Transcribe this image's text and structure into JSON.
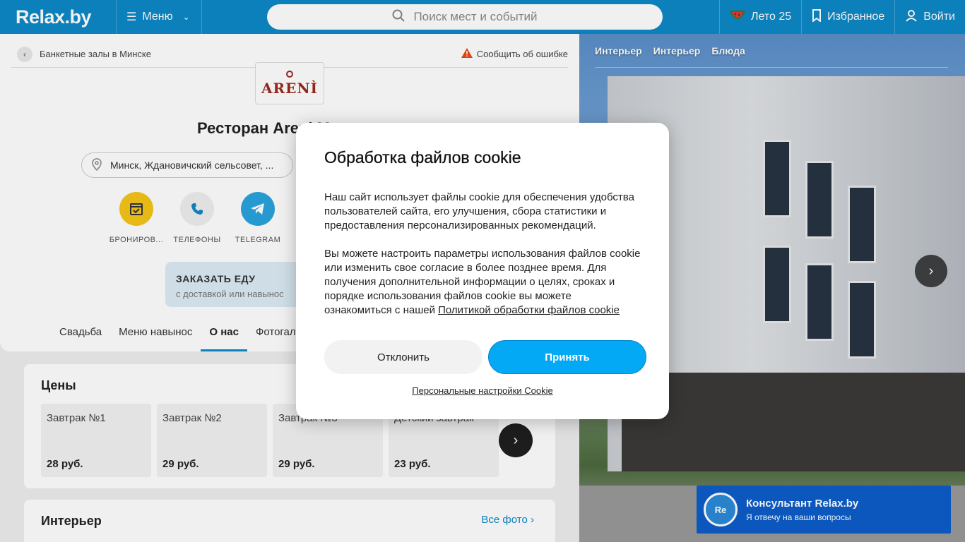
{
  "header": {
    "logo": "Relax.by",
    "menu_label": "Меню",
    "search_placeholder": "Поиск мест и событий",
    "summer_label": "Лето 25",
    "favorites_label": "Избранное",
    "login_label": "Войти"
  },
  "breadcrumb": {
    "label": "Банкетные залы в Минске",
    "report_label": "Сообщить об ошибке"
  },
  "venue": {
    "logo_text": "ARENÌ",
    "title": "Ресторан Areni Минск",
    "address": "Минск, Ждановичский сельсовет, ..."
  },
  "actions": [
    {
      "label": "БРОНИРОВ...",
      "color": "#f5c518"
    },
    {
      "label": "ТЕЛЕФОНЫ",
      "color": "#eeeeee"
    },
    {
      "label": "TELEGRAM",
      "color": "#2aa3df"
    }
  ],
  "order_food": {
    "title": "ЗАКАЗАТЬ ЕДУ",
    "subtitle": "с доставкой или навынос"
  },
  "tabs": [
    {
      "label": "Свадьба"
    },
    {
      "label": "Меню навынос"
    },
    {
      "label": "О нас"
    },
    {
      "label": "Фотогалерея"
    }
  ],
  "prices": {
    "title": "Цены",
    "items": [
      {
        "name": "Завтрак №1",
        "price": "28 руб."
      },
      {
        "name": "Завтрак №2",
        "price": "29 руб."
      },
      {
        "name": "Завтрак №3",
        "price": "29 руб."
      },
      {
        "name": "Детский завтрак",
        "price": "23 руб."
      }
    ]
  },
  "interior": {
    "title": "Интерьер",
    "all_photos": "Все фото"
  },
  "photo_tabs": [
    "Интерьер",
    "Интерьер",
    "Блюда"
  ],
  "consultant": {
    "avatar": "Re",
    "title": "Консультант Relax.by",
    "subtitle": "Я отвечу на ваши вопросы"
  },
  "cookie_modal": {
    "title": "Обработка файлов cookie",
    "para1": "Наш сайт использует файлы cookie для обеспечения удобства пользователей сайта, его улучшения, сбора статистики и предоставления персонализированных рекомендаций.",
    "para2": "Вы можете настроить параметры использования файлов cookie или изменить свое согласие в более позднее время. Для получения дополнительной информации о целях, сроках и порядке использования файлов cookie вы можете ознакомиться с нашей",
    "policy_link": "Политикой обработки файлов cookie",
    "decline_label": "Отклонить",
    "accept_label": "Принять",
    "settings_link": "Персональные настройки Cookie"
  },
  "colors": {
    "brand": "#0c88c6",
    "accept": "#03a9f4"
  }
}
